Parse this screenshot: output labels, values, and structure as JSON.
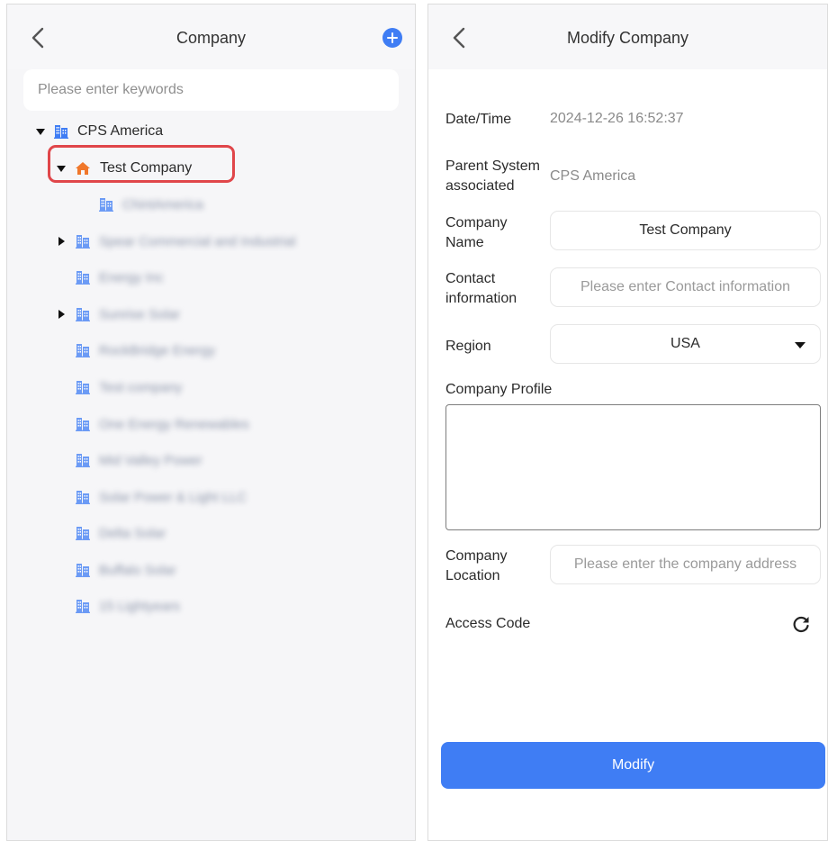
{
  "left": {
    "title": "Company",
    "search_placeholder": "Please enter keywords",
    "tree": {
      "root": "CPS America",
      "selected": "Test Company",
      "selected_child": "ChintAmerica",
      "items": [
        "Spear Commercial and Industrial",
        "Energy Inc",
        "Sunrise Solar",
        "RockBridge Energy",
        "Test company",
        "One Energy Renewables",
        "Mid Valley Power",
        "Solar Power & Light LLC",
        "Delta Solar",
        "Buffalo Solar",
        "15 Lightyears"
      ]
    }
  },
  "right": {
    "title": "Modify Company",
    "date_label": "Date/Time",
    "date_value": "2024-12-26 16:52:37",
    "parent_label_1": "Parent System",
    "parent_label_2": "associated",
    "parent_value": "CPS America",
    "name_label_1": "Company",
    "name_label_2": "Name",
    "name_value": "Test Company",
    "contact_label_1": "Contact",
    "contact_label_2": "information",
    "contact_placeholder": "Please enter Contact information",
    "region_label": "Region",
    "region_value": "USA",
    "profile_label": "Company Profile",
    "location_label_1": "Company",
    "location_label_2": "Location",
    "location_placeholder": "Please enter the company address",
    "access_label": "Access Code",
    "modify_button": "Modify"
  },
  "colors": {
    "accent": "#3f7df4",
    "highlight": "#e0464a",
    "home_icon": "#f0772b",
    "building_icon": "#3f7df4"
  }
}
